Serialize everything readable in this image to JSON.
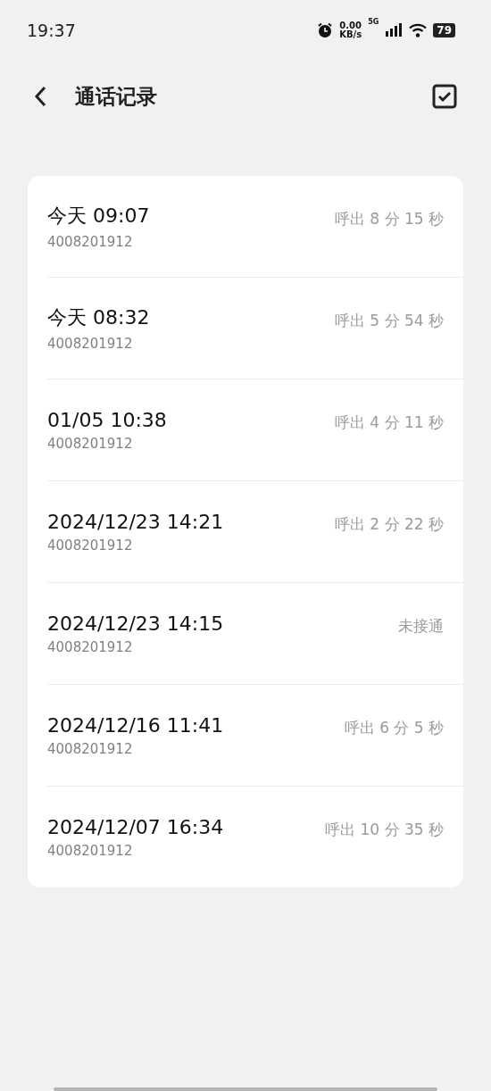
{
  "status_bar": {
    "time": "19:37",
    "net_speed_value": "0.00",
    "net_speed_unit": "KB/s",
    "network_type": "5G",
    "battery": "79"
  },
  "header": {
    "title": "通话记录"
  },
  "calls": [
    {
      "time": "今天 09:07",
      "number": "4008201912",
      "result": "呼出 8 分 15 秒"
    },
    {
      "time": "今天 08:32",
      "number": "4008201912",
      "result": "呼出 5 分 54 秒"
    },
    {
      "time": "01/05 10:38",
      "number": "4008201912",
      "result": "呼出 4 分 11 秒"
    },
    {
      "time": "2024/12/23 14:21",
      "number": "4008201912",
      "result": "呼出 2 分 22 秒"
    },
    {
      "time": "2024/12/23 14:15",
      "number": "4008201912",
      "result": "未接通"
    },
    {
      "time": "2024/12/16 11:41",
      "number": "4008201912",
      "result": "呼出 6 分 5 秒"
    },
    {
      "time": "2024/12/07 16:34",
      "number": "4008201912",
      "result": "呼出 10 分 35 秒"
    }
  ]
}
